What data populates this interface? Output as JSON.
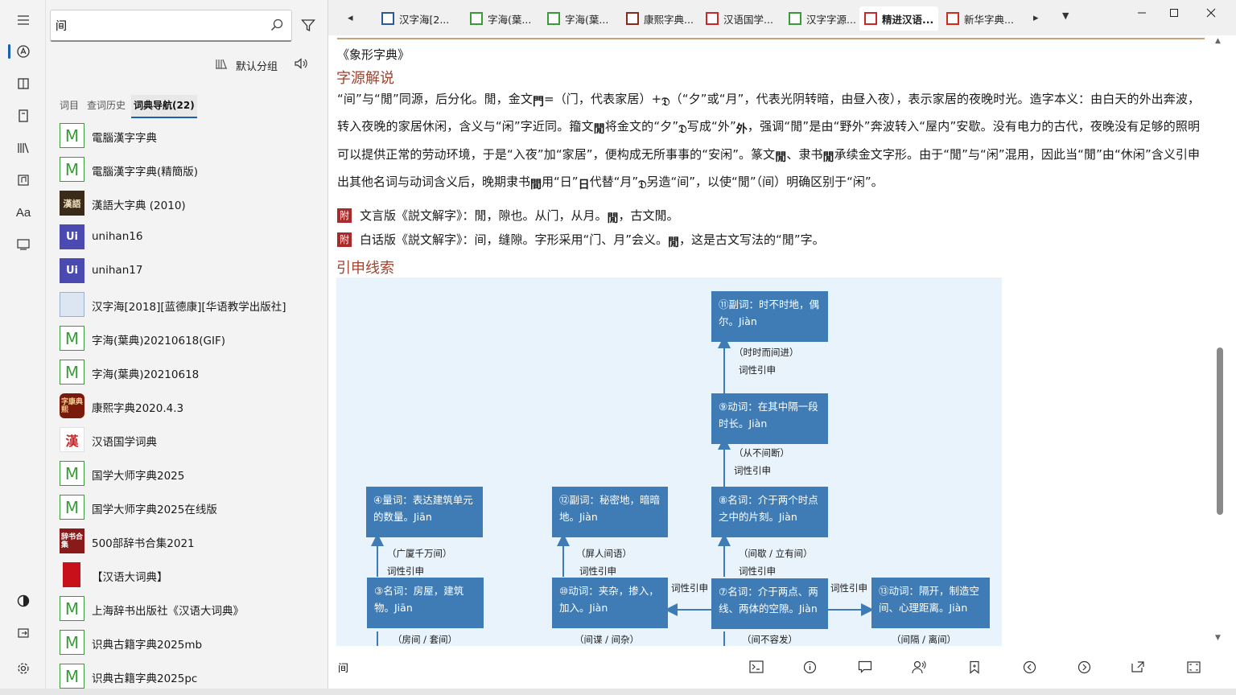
{
  "search": {
    "query": "间"
  },
  "left_panel": {
    "group_label": "默认分组",
    "tabs": [
      {
        "label": "词目"
      },
      {
        "label": "查词历史"
      },
      {
        "label": "词典导航(22)"
      }
    ],
    "dictionaries": [
      {
        "icon": "M",
        "icon_style": "m",
        "label": "電腦漢字字典"
      },
      {
        "icon": "M",
        "icon_style": "m",
        "label": "電腦漢字字典(精簡版)"
      },
      {
        "icon": "漢語",
        "icon_style": "dark",
        "label": "漢語大字典 (2010)"
      },
      {
        "icon": "Ui",
        "icon_style": "uni",
        "label": "unihan16"
      },
      {
        "icon": "Ui",
        "icon_style": "uni",
        "label": "unihan17"
      },
      {
        "icon": "",
        "icon_style": "book",
        "label": "汉字海[2018][蓝德康][华语教学出版社]"
      },
      {
        "icon": "M",
        "icon_style": "m",
        "label": "字海(葉典)20210618(GIF)"
      },
      {
        "icon": "M",
        "icon_style": "m",
        "label": "字海(葉典)20210618"
      },
      {
        "icon": "字康典熙",
        "icon_style": "kangxi",
        "label": "康熙字典2020.4.3"
      },
      {
        "icon": "漢",
        "icon_style": "hanyu",
        "label": "汉语国学词典"
      },
      {
        "icon": "M",
        "icon_style": "m",
        "label": "国学大师字典2025"
      },
      {
        "icon": "M",
        "icon_style": "m",
        "label": "国学大师字典2025在线版"
      },
      {
        "icon": "辞书合集",
        "icon_style": "cishu",
        "label": "500部辞书合集2021"
      },
      {
        "icon": "",
        "icon_style": "red",
        "label": "【汉语大词典】"
      },
      {
        "icon": "M",
        "icon_style": "m",
        "label": "上海辞书出版社《汉语大词典》"
      },
      {
        "icon": "M",
        "icon_style": "m",
        "label": "识典古籍字典2025mb"
      },
      {
        "icon": "M",
        "icon_style": "m",
        "label": "识典古籍字典2025pc"
      }
    ]
  },
  "doc_tabs": [
    {
      "label": "汉字海[2...",
      "icon_color": "#2a5a9a"
    },
    {
      "label": "字海(葉...",
      "icon_color": "#3a9a3a"
    },
    {
      "label": "字海(葉...",
      "icon_color": "#3a9a3a"
    },
    {
      "label": "康熙字典...",
      "icon_color": "#8a2a1a"
    },
    {
      "label": "汉语国学...",
      "icon_color": "#c8282a"
    },
    {
      "label": "汉字字源...",
      "icon_color": "#3a9a3a"
    },
    {
      "label": "精进汉语...",
      "icon_color": "#c8282a"
    },
    {
      "label": "新华字典...",
      "icon_color": "#d42a1a"
    }
  ],
  "content": {
    "source_title": "《象形字典》",
    "section1": "字源解说",
    "para1_parts": [
      "“间”与“閒”同源，后分化。閒，金文",
      "=",
      "（门，代表家居）+",
      "（“夕”或“月”，代表光阴转暗，由昼入夜），表示家居的夜晚时光。造字本义：由白天的外出奔波，转入夜晚的家居休闲，含义与“闲”字近同。籀文",
      "将金文的“夕”",
      "写成“外”",
      "，强调“閒”是由“野外”奔波转入“屋内”安歇。没有电力的古代，夜晚没有足够的照明可以提供正常的劳动环境，于是“入夜”加“家居”，便构成无所事事的“安闲”。篆文",
      "、隶书",
      "承续金文字形。由于“閒”与“闲”混用，因此当“閒”由“休闲”含义引申出其他名词与动词含义后，晚期隶书",
      "用“日”",
      "代替“月”",
      "另造“间”，以使“閒”（间）明确区别于“闲”。"
    ],
    "fu_badge": "附",
    "fu1": "文言版《説文解字》：閒，隙也。从门，从月。",
    "fu1_tail": "，古文閒。",
    "fu2": "白话版《説文解字》：间，缝隙。字形采用“门、月”会义。",
    "fu2_tail": "，这是古文写法的“閒”字。",
    "section2": "引申线索"
  },
  "diagram": {
    "nodes": {
      "n11": "⑪副词：时不时地，偶尔。Jiàn",
      "n9": "⑨动词：在其中隔一段时长。Jiàn",
      "n8": "⑧名词：介于两个时点之中的片刻。Jiàn",
      "n4": "④量词：表达建筑单元的数量。Jiān",
      "n12": "⑫副词：秘密地，暗暗地。Jiàn",
      "n3": "③名词：房屋，建筑物。Jiān",
      "n10": "⑩动词：夹杂，掺入，加入。Jiàn",
      "n7": "⑦名词：介于两点、两线、两体的空隙。Jiàn",
      "n13": "⑬动词：隔开，制造空间、心理距离。Jiàn"
    },
    "edges": {
      "e11": "（时时而间进）",
      "e9": "（从不间断）",
      "e8": "（间歇 / 立有间）",
      "e4": "（广厦千万间）",
      "e12": "（屏人间语）",
      "e3": "（房间 / 套间）",
      "e10": "（间谍 / 间杂）",
      "e7": "（间不容发）",
      "e13": "（间隔 / 离间）",
      "rel": "词性引申"
    }
  },
  "bottom": {
    "word": "间"
  }
}
